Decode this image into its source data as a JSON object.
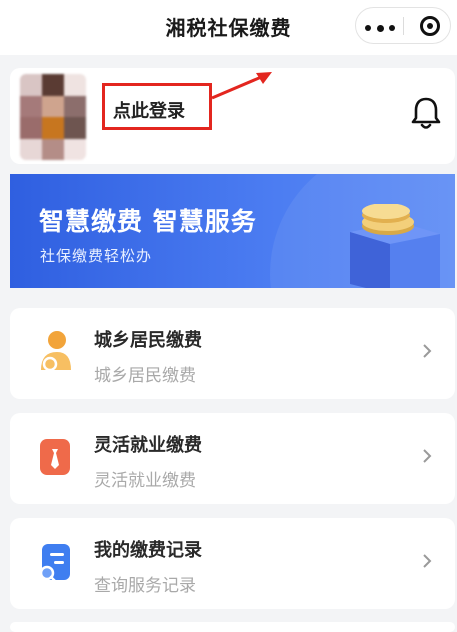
{
  "header": {
    "title": "湘税社保缴费"
  },
  "user": {
    "login_label": "点此登录"
  },
  "banner": {
    "title": "智慧缴费  智慧服务",
    "subtitle": "社保缴费轻松办"
  },
  "menu": [
    {
      "title": "城乡居民缴费",
      "subtitle": "城乡居民缴费",
      "icon": "resident-user-icon"
    },
    {
      "title": "灵活就业缴费",
      "subtitle": "灵活就业缴费",
      "icon": "tie-employment-icon"
    },
    {
      "title": "我的缴费记录",
      "subtitle": "查询服务记录",
      "icon": "record-search-icon"
    }
  ],
  "colors": {
    "highlight_red": "#e3261f",
    "banner_blue": "#3e6ee8",
    "icon_orange": "#f2a43a",
    "icon_red": "#ef6a4a",
    "icon_blue": "#3f7ef0"
  }
}
